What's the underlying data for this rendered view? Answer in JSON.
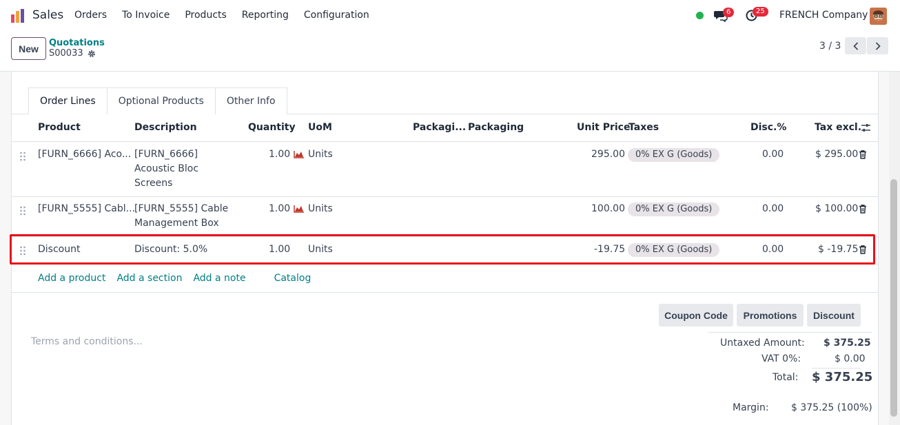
{
  "nav": {
    "app_name": "Sales",
    "menu": [
      "Orders",
      "To Invoice",
      "Products",
      "Reporting",
      "Configuration"
    ],
    "chat_count": "6",
    "activity_count": "25",
    "company": "FRENCH Company"
  },
  "control": {
    "new_label": "New",
    "breadcrumb": "Quotations",
    "record_name": "S00033",
    "pager": "3 / 3"
  },
  "tabs": [
    "Order Lines",
    "Optional Products",
    "Other Info"
  ],
  "columns": {
    "product": "Product",
    "description": "Description",
    "quantity": "Quantity",
    "uom": "UoM",
    "packaging_qty": "Packagi...",
    "packaging": "Packaging",
    "unit_price": "Unit Price",
    "taxes": "Taxes",
    "disc": "Disc.%",
    "tax_excl": "Tax excl."
  },
  "rows": [
    {
      "product": "[FURN_6666] Aco...",
      "description": [
        "[FURN_6666]",
        "Acoustic Bloc",
        "Screens"
      ],
      "quantity": "1.00",
      "uom": "Units",
      "unit_price": "295.00",
      "tax": "0% EX G (Goods)",
      "disc": "0.00",
      "subtotal": "$ 295.00"
    },
    {
      "product": "[FURN_5555] Cabl...",
      "description": [
        "[FURN_5555] Cable",
        "Management Box"
      ],
      "quantity": "1.00",
      "uom": "Units",
      "unit_price": "100.00",
      "tax": "0% EX G (Goods)",
      "disc": "0.00",
      "subtotal": "$ 100.00"
    },
    {
      "product": "Discount",
      "description": [
        "Discount: 5.0%"
      ],
      "quantity": "1.00",
      "uom": "Units",
      "unit_price": "-19.75",
      "tax": "0% EX G (Goods)",
      "disc": "0.00",
      "subtotal": "$ -19.75"
    }
  ],
  "add_links": {
    "product": "Add a product",
    "section": "Add a section",
    "note": "Add a note",
    "catalog": "Catalog"
  },
  "buttons": {
    "coupon": "Coupon Code",
    "promotions": "Promotions",
    "discount": "Discount"
  },
  "terms_placeholder": "Terms and conditions...",
  "totals": {
    "untaxed_label": "Untaxed Amount:",
    "untaxed_value": "$ 375.25",
    "vat_label": "VAT 0%:",
    "vat_value": "$ 0.00",
    "total_label": "Total:",
    "total_value": "$ 375.25",
    "margin_label": "Margin:",
    "margin_value": "$ 375.25 (100%)"
  },
  "colors": {
    "brand": "#714b67",
    "link": "#017e84",
    "highlight": "#e8101a"
  }
}
